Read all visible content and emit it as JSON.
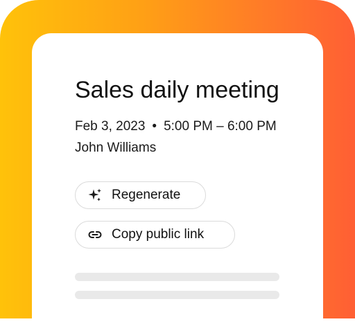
{
  "meeting": {
    "title": "Sales daily meeting",
    "date": "Feb 3, 2023",
    "separator": "•",
    "time": "5:00 PM – 6:00 PM",
    "owner": "John Williams"
  },
  "actions": {
    "regenerate": {
      "label": "Regenerate",
      "icon": "sparkles-icon"
    },
    "copy_link": {
      "label": "Copy public link",
      "icon": "link-icon"
    }
  },
  "colors": {
    "gradient_start": "#FFC20A",
    "gradient_end": "#FF5F34",
    "card_background": "#FFFFFF",
    "pill_border": "#DADADA",
    "skeleton": "#E9E9E9",
    "text": "#111111"
  }
}
